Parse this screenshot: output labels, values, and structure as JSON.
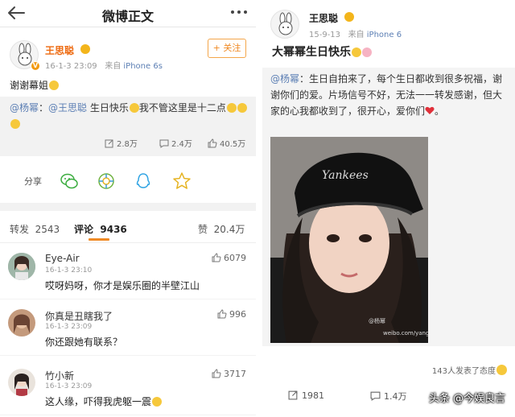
{
  "left": {
    "topbar": {
      "title": "微博正文",
      "back_icon": "back-arrow-icon",
      "more_icon": "more-dots-icon"
    },
    "post": {
      "author": "王思聪",
      "time": "16-1-3  23:09",
      "source_prefix": "来自",
      "source": "iPhone 6s",
      "follow_label": "+ 关注",
      "text": "谢谢幕姐",
      "repost": {
        "mention1": "@杨幂",
        "sep": "：",
        "mention2": "@王思聪",
        "text": " 生日快乐",
        "text2": "我不管这里是十二点"
      },
      "stats": {
        "reposts": "2.8万",
        "comments": "2.4万",
        "likes": "40.5万"
      }
    },
    "share": {
      "label": "分享",
      "icons": [
        "wechat-icon",
        "moments-icon",
        "qq-icon",
        "qzone-icon"
      ]
    },
    "tabs": [
      {
        "label": "转发",
        "count": "2543"
      },
      {
        "label": "评论",
        "count": "9436"
      },
      {
        "label": "赞",
        "count": "20.4万"
      }
    ],
    "comments": [
      {
        "name": "Eye-Air",
        "time": "16-1-3  23:10",
        "text": "哎呀妈呀，你才是娱乐圈的半壁江山",
        "likes": "6079"
      },
      {
        "name": "你真是丑瞎我了",
        "time": "16-1-3  23:09",
        "text": "你还跟她有联系？",
        "likes": "996"
      },
      {
        "name": "竹小新",
        "time": "16-1-3  23:09",
        "text": "这人缘，吓得我虎躯一震",
        "likes": "3717"
      }
    ]
  },
  "right": {
    "author": "王思聪",
    "time": "15-9-13",
    "source_prefix": "来自",
    "source": "iPhone 6",
    "title": "大幂幂生日快乐",
    "quote": {
      "mention": "@杨幂",
      "text": "：生日自拍来了，每个生日都收到很多祝福，谢谢你们的爱。片场信号不好，无法一一转发感谢，但大家的心我都收到了，很开心，爱你们"
    },
    "photo_watermark_1": "@杨幂",
    "photo_watermark_2": "weibo.com/yangmiblog",
    "attitude": "143人发表了态度",
    "stats": {
      "reposts": "1981",
      "comments": "1.4万"
    },
    "source_watermark": "头条 @今娱良言"
  },
  "colors": {
    "accent": "#f08a24",
    "link": "#5c7fb4",
    "name": "#ee6b12",
    "quote_bg": "#f2f2f2"
  }
}
